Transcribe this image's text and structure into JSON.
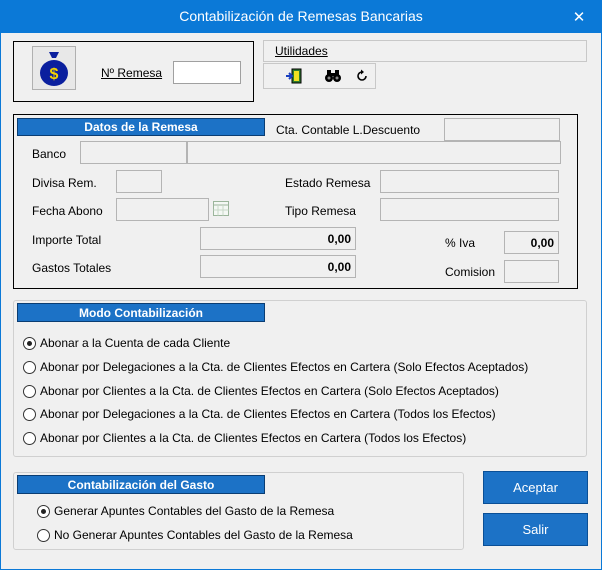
{
  "window": {
    "title": "Contabilización de Remesas Bancarias",
    "close_glyph": "✕"
  },
  "header": {
    "remesa_label": "Nº Remesa",
    "remesa_value": "",
    "utilidades_label": "Utilidades"
  },
  "toolbar": {
    "icons": [
      "exit-door-icon",
      "binoculars-icon",
      "refresh-icon"
    ]
  },
  "datos": {
    "title": "Datos de la Remesa",
    "cta_label": "Cta. Contable L.Descuento",
    "cta_value": "",
    "banco_label": "Banco",
    "banco_code": "",
    "banco_name": "",
    "divisa_label": "Divisa Rem.",
    "divisa_value": "",
    "estado_label": "Estado Remesa",
    "estado_value": "",
    "fecha_label": "Fecha Abono",
    "fecha_value": "",
    "tipo_label": "Tipo Remesa",
    "tipo_value": "",
    "importe_label": "Importe Total",
    "importe_value": "0,00",
    "iva_label": "% Iva",
    "iva_value": "0,00",
    "gastos_label": "Gastos Totales",
    "gastos_value": "0,00",
    "comision_label": "Comision",
    "comision_value": ""
  },
  "modo": {
    "title": "Modo Contabilización",
    "options": [
      {
        "label": "Abonar a la Cuenta de cada Cliente",
        "selected": true
      },
      {
        "label": "Abonar por Delegaciones a la Cta. de Clientes Efectos en Cartera (Solo Efectos Aceptados)",
        "selected": false
      },
      {
        "label": "Abonar por Clientes a la Cta. de Clientes Efectos en Cartera (Solo Efectos Aceptados)",
        "selected": false
      },
      {
        "label": "Abonar por Delegaciones a la Cta. de Clientes Efectos en Cartera (Todos los Efectos)",
        "selected": false
      },
      {
        "label": "Abonar por Clientes a la Cta. de Clientes Efectos en Cartera (Todos los Efectos)",
        "selected": false
      }
    ]
  },
  "gasto": {
    "title": "Contabilización del Gasto",
    "options": [
      {
        "label": "Generar Apuntes Contables del Gasto de la Remesa",
        "selected": true
      },
      {
        "label": "No Generar Apuntes Contables del Gasto de la Remesa",
        "selected": false
      }
    ]
  },
  "buttons": {
    "aceptar": "Aceptar",
    "salir": "Salir"
  },
  "colors": {
    "titlebar": "#0b79d7",
    "accent": "#1c72c6",
    "background": "#f0f0f0"
  }
}
